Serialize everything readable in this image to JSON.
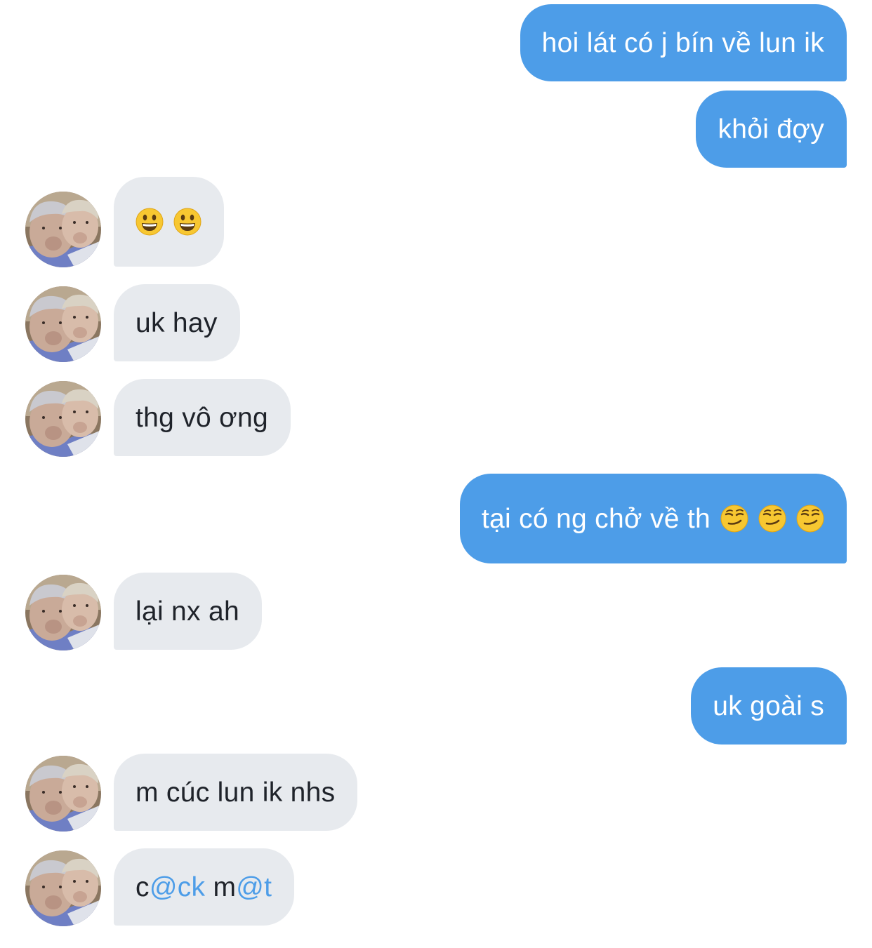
{
  "messages": [
    {
      "id": "m1",
      "side": "out",
      "text": "hoi lát có j bín về lun ik"
    },
    {
      "id": "m2",
      "side": "out",
      "text": "khỏi đợy"
    },
    {
      "id": "m3",
      "side": "in",
      "emojis": [
        "grinning-face-emoji",
        "grinning-face-emoji"
      ]
    },
    {
      "id": "m4",
      "side": "in",
      "text": "uk hay"
    },
    {
      "id": "m5",
      "side": "in",
      "text": "thg vô ơng"
    },
    {
      "id": "m6",
      "side": "out",
      "text": "tại có ng chở về th",
      "emojis": [
        "smirking-face-emoji",
        "smirking-face-emoji",
        "smirking-face-emoji"
      ]
    },
    {
      "id": "m7",
      "side": "in",
      "text": "lại nx ah"
    },
    {
      "id": "m8",
      "side": "out",
      "text": "uk goài s"
    },
    {
      "id": "m9",
      "side": "in",
      "text": "m cúc lun ik nhs"
    },
    {
      "id": "m10",
      "side": "in",
      "parts": {
        "p1": "c",
        "p2": "@ck",
        "p3": " m",
        "p4": "@t"
      }
    }
  ],
  "colors": {
    "outgoing_bubble": "#4d9de8",
    "incoming_bubble": "#e7eaee",
    "mention": "#4d9de8"
  },
  "avatar_icon": "contact-avatar-photo"
}
